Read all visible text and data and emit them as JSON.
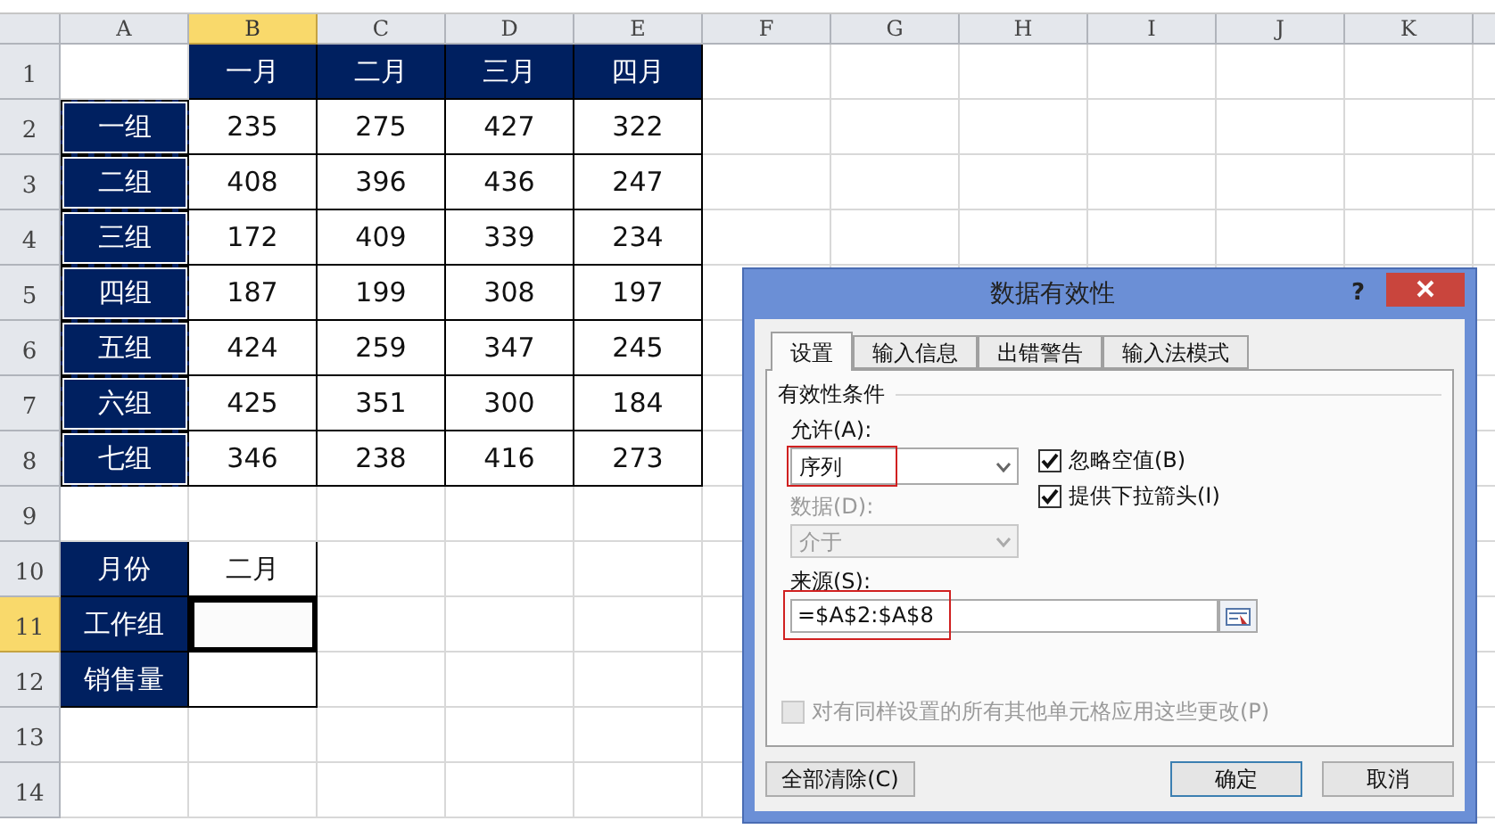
{
  "sheet": {
    "columns": [
      {
        "label": "A",
        "selected": false
      },
      {
        "label": "B",
        "selected": true
      },
      {
        "label": "C",
        "selected": false
      },
      {
        "label": "D",
        "selected": false
      },
      {
        "label": "E",
        "selected": false
      },
      {
        "label": "F",
        "selected": false
      },
      {
        "label": "G",
        "selected": false
      },
      {
        "label": "H",
        "selected": false
      },
      {
        "label": "I",
        "selected": false
      },
      {
        "label": "J",
        "selected": false
      },
      {
        "label": "K",
        "selected": false
      }
    ],
    "rows": [
      {
        "label": "1",
        "selected": false
      },
      {
        "label": "2",
        "selected": false
      },
      {
        "label": "3",
        "selected": false
      },
      {
        "label": "4",
        "selected": false
      },
      {
        "label": "5",
        "selected": false
      },
      {
        "label": "6",
        "selected": false
      },
      {
        "label": "7",
        "selected": false
      },
      {
        "label": "8",
        "selected": false
      },
      {
        "label": "9",
        "selected": false
      },
      {
        "label": "10",
        "selected": false
      },
      {
        "label": "11",
        "selected": true
      },
      {
        "label": "12",
        "selected": false
      },
      {
        "label": "13",
        "selected": false
      },
      {
        "label": "14",
        "selected": false
      }
    ],
    "sales_table": {
      "months": [
        "一月",
        "二月",
        "三月",
        "四月"
      ],
      "groups": [
        {
          "name": "一组",
          "values": [
            "235",
            "275",
            "427",
            "322"
          ]
        },
        {
          "name": "二组",
          "values": [
            "408",
            "396",
            "436",
            "247"
          ]
        },
        {
          "name": "三组",
          "values": [
            "172",
            "409",
            "339",
            "234"
          ]
        },
        {
          "name": "四组",
          "values": [
            "187",
            "199",
            "308",
            "197"
          ]
        },
        {
          "name": "五组",
          "values": [
            "424",
            "259",
            "347",
            "245"
          ]
        },
        {
          "name": "六组",
          "values": [
            "425",
            "351",
            "300",
            "184"
          ]
        },
        {
          "name": "七组",
          "values": [
            "346",
            "238",
            "416",
            "273"
          ]
        }
      ]
    },
    "lookup": [
      {
        "label": "月份",
        "value": "二月",
        "selected": false
      },
      {
        "label": "工作组",
        "selected": true
      },
      {
        "label": "销售量",
        "selected": false
      }
    ]
  },
  "dialog": {
    "title": "数据有效性",
    "help": "?",
    "tabs": [
      {
        "label": "设置",
        "selected": true
      },
      {
        "label": "输入信息",
        "selected": false
      },
      {
        "label": "出错警告",
        "selected": false
      },
      {
        "label": "输入法模式",
        "selected": false
      }
    ],
    "group_title": "有效性条件",
    "allow": {
      "label": "允许(A):",
      "value": "序列",
      "highlighted": true
    },
    "data": {
      "label": "数据(D):",
      "value": "介于",
      "disabled": true
    },
    "checkboxes": [
      {
        "label": "忽略空值(B)",
        "checked": true
      },
      {
        "label": "提供下拉箭头(I)",
        "checked": true
      }
    ],
    "source": {
      "label": "来源(S):",
      "value": "=$A$2:$A$8",
      "highlighted": true
    },
    "apply_all": {
      "label": "对有同样设置的所有其他单元格应用这些更改(P)",
      "checked": false,
      "disabled": true
    },
    "buttons": [
      {
        "label": "全部清除(C)",
        "default": false
      },
      {
        "label": "确定",
        "default": true
      },
      {
        "label": "取消",
        "default": false
      }
    ]
  }
}
